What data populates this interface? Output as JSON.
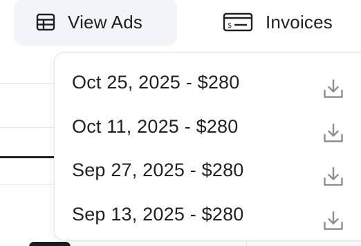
{
  "toolbar": {
    "view_ads": {
      "label": "View Ads",
      "icon": "table-grid-icon"
    },
    "invoices": {
      "label": "Invoices",
      "icon": "invoice-card-icon"
    }
  },
  "invoices_menu": {
    "items": [
      {
        "label": "Oct 25, 2025 - $280",
        "icon": "download-icon"
      },
      {
        "label": "Oct 11, 2025 - $280",
        "icon": "download-icon"
      },
      {
        "label": "Sep 27, 2025 - $280",
        "icon": "download-icon"
      },
      {
        "label": "Sep 13, 2025 - $280",
        "icon": "download-icon"
      }
    ]
  },
  "colors": {
    "text": "#1f2023",
    "muted_icon": "#8a8d93",
    "button_bg": "#f3f4f6",
    "border": "#e3e4e8"
  }
}
